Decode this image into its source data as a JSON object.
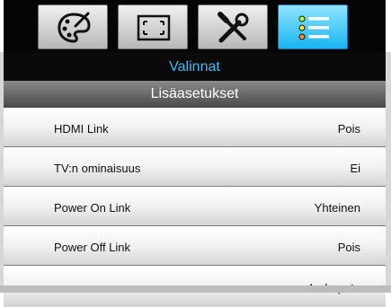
{
  "tabs": [
    {
      "icon": "palette-icon"
    },
    {
      "icon": "screen-resize-icon"
    },
    {
      "icon": "tools-icon"
    },
    {
      "icon": "list-icon"
    }
  ],
  "menu_title": "Valinnat",
  "submenu_title": "Lisäasetukset",
  "rows": [
    {
      "label": "HDMI Link",
      "value": "Pois"
    },
    {
      "label": "TV:n ominaisuus",
      "value": "Ei"
    },
    {
      "label": "Power On Link",
      "value": "Yhteinen"
    },
    {
      "label": "Power Off Link",
      "value": "Pois"
    }
  ],
  "exit_label": "Lopeta",
  "colors": {
    "title_text": "#3cbbf3",
    "active_tab": "#19b4f0"
  }
}
